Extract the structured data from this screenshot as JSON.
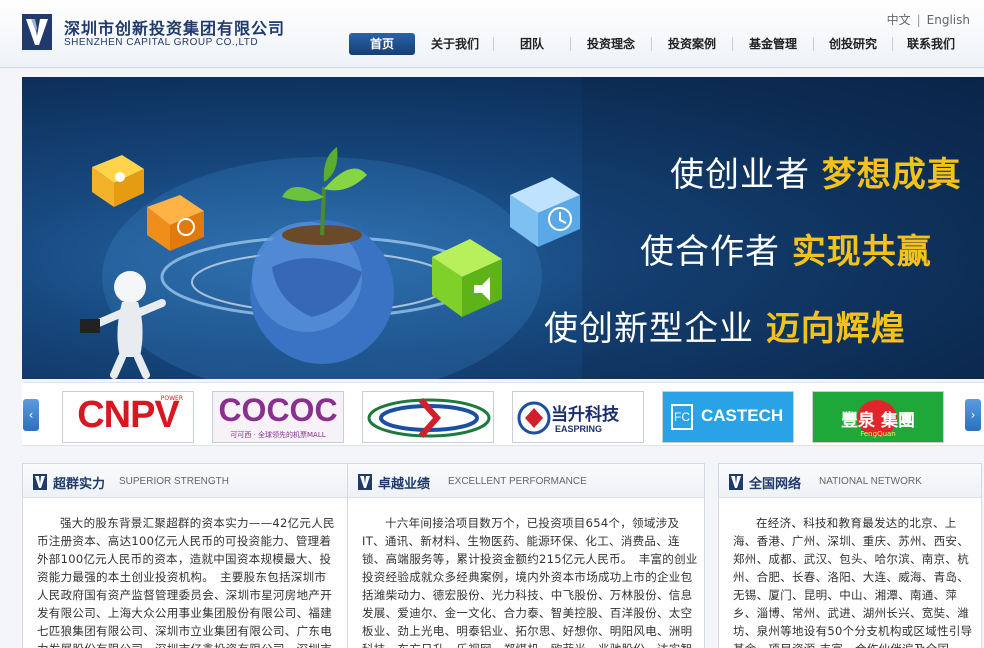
{
  "brand": {
    "name_cn": "深圳市创新投资集团有限公司",
    "name_en": "SHENZHEN CAPITAL GROUP CO.,LTD"
  },
  "lang": {
    "cn": "中文",
    "sep": "|",
    "en": "English"
  },
  "nav": [
    {
      "label": "首页",
      "active": true
    },
    {
      "label": "关于我们"
    },
    {
      "label": "团队"
    },
    {
      "label": "投资理念"
    },
    {
      "label": "投资案例"
    },
    {
      "label": "基金管理"
    },
    {
      "label": "创投研究"
    },
    {
      "label": "联系我们"
    }
  ],
  "banner": {
    "slogans": [
      {
        "plain": "使创业者",
        "highlight": "梦想成真"
      },
      {
        "plain": "使合作者",
        "highlight": "实现共赢"
      },
      {
        "plain": "使创新型企业",
        "highlight": "迈向辉煌"
      }
    ]
  },
  "partners": {
    "prev": "‹",
    "next": "›",
    "logos": [
      {
        "text": "CNPV",
        "small": "POWER"
      },
      {
        "text": "COCOC",
        "small": "可可西 · 全球领先的机票MALL"
      },
      {
        "text": ""
      },
      {
        "text": "当升科技",
        "small": "EASPRING"
      },
      {
        "text": "CASTECH"
      },
      {
        "text": "豐泉  集團",
        "small": "FengQuan"
      }
    ]
  },
  "panels": [
    {
      "title": "超群实力",
      "subtitle": "SUPERIOR STRENGTH",
      "body": "强大的股东背景汇聚超群的资本实力——42亿元人民币注册资本、高达100亿元人民币的可投资能力、管理着外部100亿元人民币的资本，造就中国资本规模最大、投资能力最强的本土创业投资机构。　主要股东包括深圳市人民政府国有资产监督管理委员会、深圳市星河房地产开发有限公司、上海大众公用事业集团股份有限公司、福建七匹狼集团有限公司、深圳市立业集团有限公司、广东电力发展股份有限公司、深圳市亿鑫投资有限公司、深圳市福田投资发展公司等。国内创业投"
    },
    {
      "title": "卓越业绩",
      "subtitle": "EXCELLENT PERFORMANCE",
      "body": "十六年间接洽项目数万个，已投资项目654个，领域涉及IT、通讯、新材料、生物医药、能源环保、化工、消费品、连锁、高端服务等，累计投资金额约215亿元人民币。　丰富的创业投资经验成就众多经典案例，境内外资本市场成功上市的企业包括潍柴动力、德宏股份、光力科技、中飞股份、万林股份、信息发展、爱迪尔、金一文化、合力泰、智美控股、百洋股份、太空板业、劲上光电、明泰铝业、拓尔思、好想你、明阳风电、洲明科技、东方日升、乐视网、郑煤机、欧菲光、兆驰股份、达实智能、尚品宅配、奥飞动漫、大富科技、实益达、全新好"
    },
    {
      "title": "全国网络",
      "subtitle": "NATIONAL NETWORK",
      "body": "在经济、科技和教育最发达的北京、上海、香港、广州、深圳、重庆、苏州、西安、郑州、成都、武汉、包头、哈尔滨、南京、杭州、合肥、长春、洛阳、大连、威海、青岛、无锡、厦门、昆明、中山、湘潭、南通、萍乡、淄博、常州、武进、湖州长兴、宽奘、潍坊、泉州等地设有50个分支机构或区域性引导基金，项目资源 丰富，合作伙伴遍及全国。"
    }
  ]
}
